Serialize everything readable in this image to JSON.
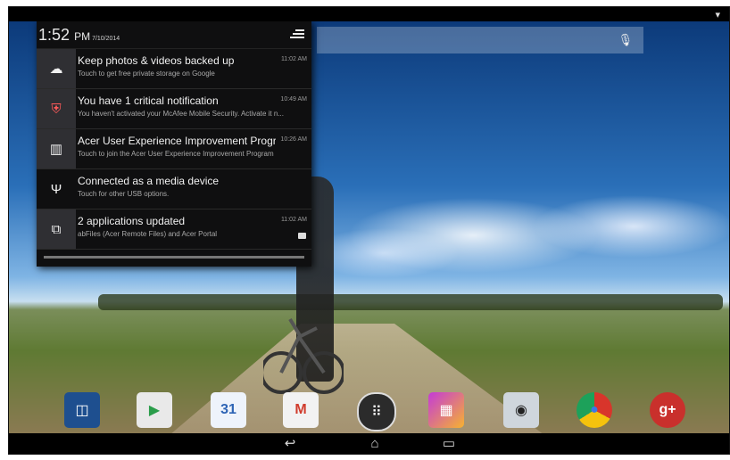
{
  "status_bar": {
    "wifi_icon": "wifi-icon"
  },
  "notification_shade": {
    "time": "1:52",
    "ampm": "PM",
    "date": "7/10/2014",
    "clear_icon": "clear-all-icon",
    "notifications": [
      {
        "icon": "cloud-upload-icon",
        "title": "Keep photos & videos backed up",
        "subtitle": "Touch to get free private storage on Google",
        "time": "11:02 AM"
      },
      {
        "icon": "mcafee-shield-icon",
        "title": "You have 1 critical notification",
        "subtitle": "You haven't activated your McAfee Mobile Security. Activate it n...",
        "time": "10:49 AM"
      },
      {
        "icon": "acer-program-icon",
        "title": "Acer User Experience Improvement Progr...",
        "subtitle": "Touch to join the Acer User Experience Improvement Program",
        "time": "10:26 AM"
      },
      {
        "icon": "usb-icon",
        "title": "Connected as a media device",
        "subtitle": "Touch for other USB options.",
        "time": ""
      },
      {
        "icon": "app-update-icon",
        "title": "2 applications updated",
        "subtitle": "abFiles (Acer Remote Files) and Acer Portal",
        "time": "11:02 AM"
      }
    ]
  },
  "search": {
    "mic_icon": "mic-icon"
  },
  "dock": {
    "apps": [
      {
        "name": "dolby-app-icon",
        "color": "#1e4f8f",
        "glyph": "◫"
      },
      {
        "name": "play-store-icon",
        "color": "#e9e9e9",
        "glyph": "▶"
      },
      {
        "name": "calendar-icon",
        "color": "#eef3fb",
        "glyph": "31"
      },
      {
        "name": "gmail-icon",
        "color": "#f2f2f2",
        "glyph": "M"
      },
      {
        "name": "app-drawer-icon",
        "color": "#2b2b2b",
        "glyph": "⠿"
      },
      {
        "name": "gallery-icon",
        "color": "#8a3fb0",
        "glyph": "▦"
      },
      {
        "name": "camera-icon",
        "color": "#cfd6dc",
        "glyph": "◉"
      },
      {
        "name": "chrome-icon",
        "color": "#d8352b",
        "glyph": "◎"
      },
      {
        "name": "google-plus-icon",
        "color": "#c9302c",
        "glyph": "g+"
      }
    ]
  },
  "navbar": {
    "back_glyph": "↩",
    "home_glyph": "⌂",
    "recents_glyph": "▭"
  }
}
